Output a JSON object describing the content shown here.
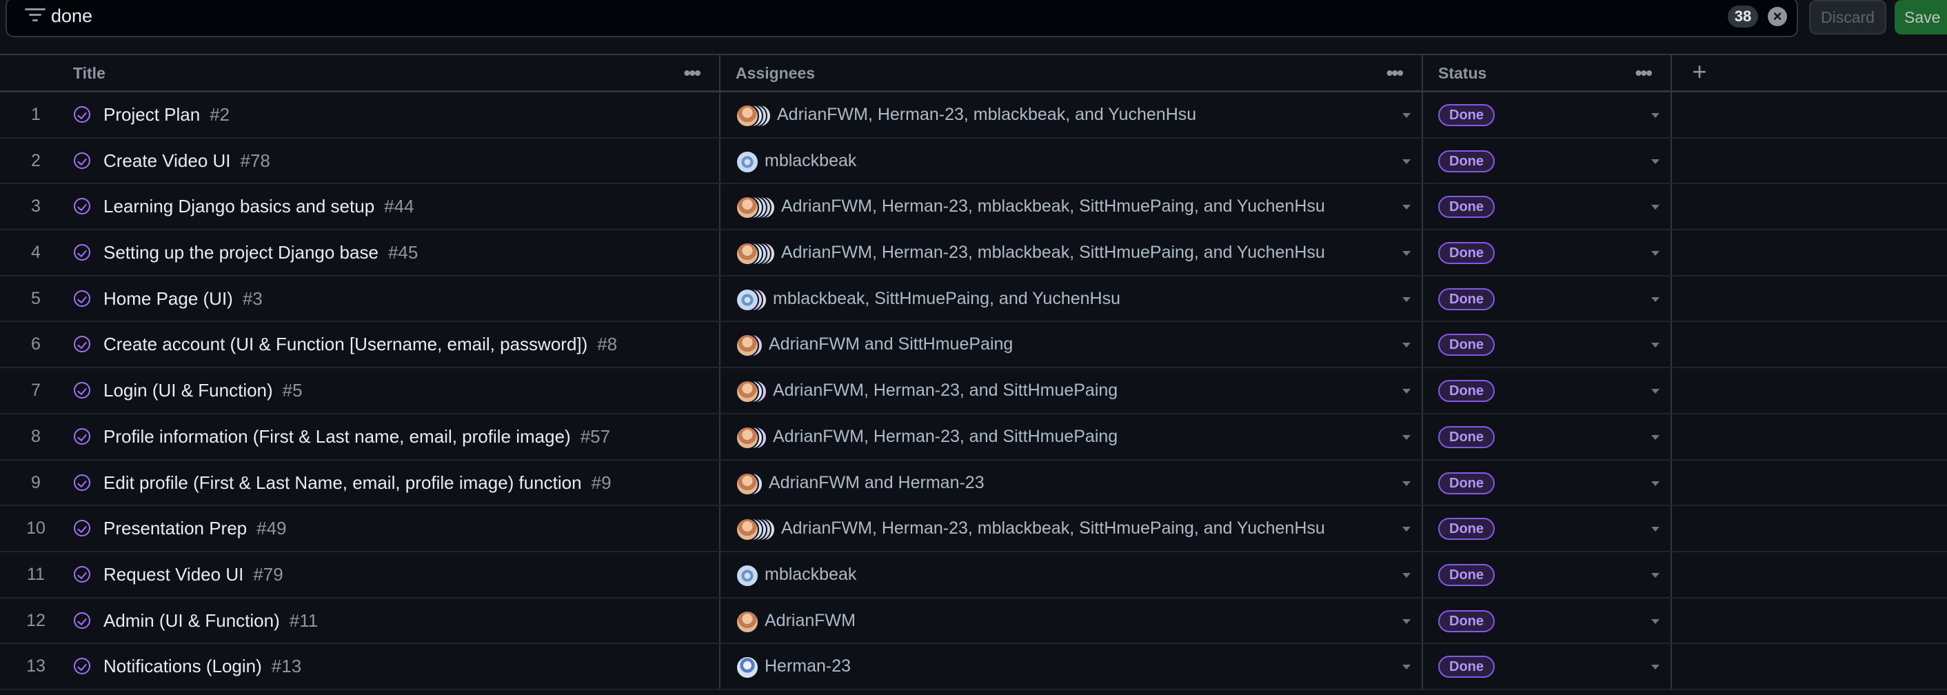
{
  "filter": {
    "query": "done",
    "count": "38",
    "discard_label": "Discard",
    "save_label": "Save"
  },
  "columns": {
    "title": "Title",
    "assignees": "Assignees",
    "status": "Status",
    "add": "+"
  },
  "icons": {
    "filter": "filter-icon",
    "clear": "x-circle-icon",
    "more": "kebab-horizontal-icon",
    "issue_closed": "issue-closed-icon",
    "dropdown": "triangle-down-icon"
  },
  "colors": {
    "background": "#0d1117",
    "done_purple": "#a371f7",
    "save_green": "#238636"
  },
  "rows": [
    {
      "n": "1",
      "title": "Project Plan",
      "issue": "#2",
      "avatars": [
        "adrian",
        "herman",
        "mblack",
        "yuchen"
      ],
      "assignees": "AdrianFWM, Herman-23, mblackbeak, and YuchenHsu",
      "status": "Done"
    },
    {
      "n": "2",
      "title": "Create Video UI",
      "issue": "#78",
      "avatars": [
        "mblack"
      ],
      "assignees": "mblackbeak",
      "status": "Done"
    },
    {
      "n": "3",
      "title": "Learning Django basics and setup",
      "issue": "#44",
      "avatars": [
        "adrian",
        "herman",
        "mblack",
        "sitt",
        "yuchen"
      ],
      "assignees": "AdrianFWM, Herman-23, mblackbeak, SittHmuePaing, and YuchenHsu",
      "status": "Done"
    },
    {
      "n": "4",
      "title": "Setting up the project Django base",
      "issue": "#45",
      "avatars": [
        "adrian",
        "herman",
        "mblack",
        "sitt",
        "yuchen"
      ],
      "assignees": "AdrianFWM, Herman-23, mblackbeak, SittHmuePaing, and YuchenHsu",
      "status": "Done"
    },
    {
      "n": "5",
      "title": "Home Page (UI)",
      "issue": "#3",
      "avatars": [
        "mblack",
        "sitt",
        "yuchen"
      ],
      "assignees": "mblackbeak, SittHmuePaing, and YuchenHsu",
      "status": "Done"
    },
    {
      "n": "6",
      "title": "Create account (UI & Function [Username, email, password])",
      "issue": "#8",
      "avatars": [
        "adrian",
        "sitt"
      ],
      "assignees": "AdrianFWM and SittHmuePaing",
      "status": "Done"
    },
    {
      "n": "7",
      "title": "Login (UI & Function)",
      "issue": "#5",
      "avatars": [
        "adrian",
        "herman",
        "sitt"
      ],
      "assignees": "AdrianFWM, Herman-23, and SittHmuePaing",
      "status": "Done"
    },
    {
      "n": "8",
      "title": "Profile information (First & Last name, email, profile image)",
      "issue": "#57",
      "avatars": [
        "adrian",
        "herman",
        "sitt"
      ],
      "assignees": "AdrianFWM, Herman-23, and SittHmuePaing",
      "status": "Done"
    },
    {
      "n": "9",
      "title": "Edit profile (First & Last Name, email, profile image) function",
      "issue": "#9",
      "avatars": [
        "adrian",
        "herman"
      ],
      "assignees": "AdrianFWM and Herman-23",
      "status": "Done"
    },
    {
      "n": "10",
      "title": "Presentation Prep",
      "issue": "#49",
      "avatars": [
        "adrian",
        "herman",
        "mblack",
        "sitt",
        "yuchen"
      ],
      "assignees": "AdrianFWM, Herman-23, mblackbeak, SittHmuePaing, and YuchenHsu",
      "status": "Done"
    },
    {
      "n": "11",
      "title": "Request Video UI",
      "issue": "#79",
      "avatars": [
        "mblack"
      ],
      "assignees": "mblackbeak",
      "status": "Done"
    },
    {
      "n": "12",
      "title": "Admin (UI & Function)",
      "issue": "#11",
      "avatars": [
        "adrian"
      ],
      "assignees": "AdrianFWM",
      "status": "Done"
    },
    {
      "n": "13",
      "title": "Notifications (Login)",
      "issue": "#13",
      "avatars": [
        "herman"
      ],
      "assignees": "Herman-23",
      "status": "Done"
    }
  ]
}
